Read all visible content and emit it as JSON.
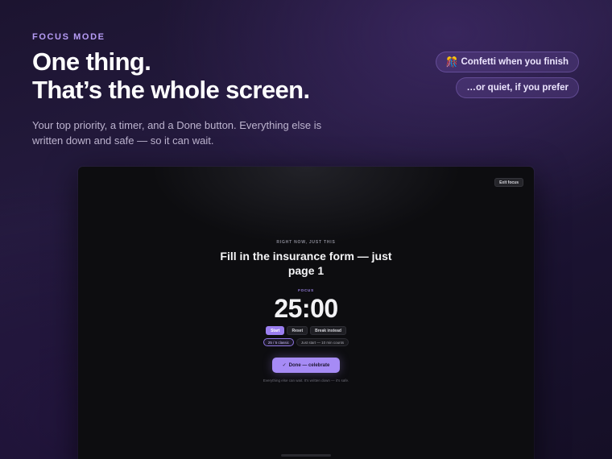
{
  "hero": {
    "eyebrow": "FOCUS MODE",
    "headline_line1": "One thing.",
    "headline_line2": "That’s the whole screen.",
    "subtitle": "Your top priority, a timer, and a Done button. Everything else is written down and safe — so it can wait."
  },
  "badges": [
    {
      "icon": "🎊",
      "label": "Confetti when you finish"
    },
    {
      "label": "…or quiet, if you prefer"
    }
  ],
  "focus_screen": {
    "exit_label": "Exit focus",
    "context_label": "RIGHT NOW, JUST THIS",
    "task_title": "Fill in the insurance form — just page 1",
    "timer_label": "FOCUS",
    "timer_value": "25:00",
    "controls": {
      "start": "Start",
      "reset": "Reset",
      "break": "Break instead"
    },
    "presets": {
      "classic": "25 / 5 classic",
      "just_start": "Just start — 10 min counts"
    },
    "done_label": "Done — celebrate",
    "done_icon": "✓",
    "footnote": "Everything else can wait. It's written down — it's safe.",
    "accent_color": "#a68bf5"
  }
}
